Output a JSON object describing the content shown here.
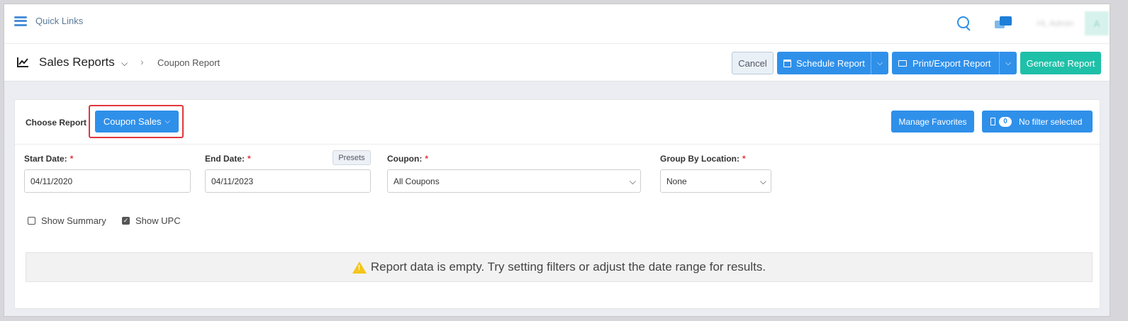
{
  "topbar": {
    "quick_links_label": "Quick Links",
    "user_name": "Hi, Admin",
    "avatar_initial": "A"
  },
  "header": {
    "title": "Sales Reports",
    "breadcrumb": "Coupon Report",
    "cancel_label": "Cancel",
    "schedule_label": "Schedule Report",
    "print_label": "Print/Export Report",
    "generate_label": "Generate Report"
  },
  "report": {
    "choose_label": "Choose Report",
    "selected_report": "Coupon Sales",
    "manage_favorites_label": "Manage Favorites",
    "filter_count": "0",
    "filter_label": "No filter selected"
  },
  "filters": {
    "start_date_label": "Start Date:",
    "start_date_value": "04/11/2020",
    "end_date_label": "End Date:",
    "end_date_value": "04/11/2023",
    "presets_label": "Presets",
    "coupon_label": "Coupon:",
    "coupon_value": "All Coupons",
    "group_by_label": "Group By Location:",
    "group_by_value": "None",
    "required_mark": "*"
  },
  "options": {
    "show_summary_label": "Show Summary",
    "show_summary_checked": false,
    "show_upc_label": "Show UPC",
    "show_upc_checked": true
  },
  "empty_message": "Report data is empty. Try setting filters or adjust the date range for results.",
  "colors": {
    "primary": "#2f90ea",
    "success": "#1fc0a8",
    "highlight": "#e0373c"
  }
}
